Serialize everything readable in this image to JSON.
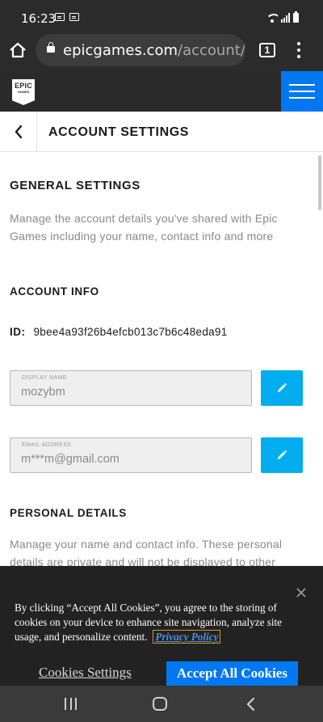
{
  "status_bar": {
    "time": "16:23"
  },
  "browser": {
    "url_host": "epicgames.com",
    "url_path": "/account/per",
    "tab_count": "1"
  },
  "site": {
    "logo_line1": "EPIC",
    "logo_line2": "GAMES"
  },
  "page": {
    "title": "ACCOUNT SETTINGS"
  },
  "general": {
    "heading": "GENERAL SETTINGS",
    "description": "Manage the account details you've shared with Epic Games including your name, contact info and more"
  },
  "account_info": {
    "heading": "ACCOUNT INFO",
    "id_label": "ID:",
    "id_value": "9bee4a93f26b4efcb013c7b6c48eda91",
    "display_name_label": "DISPLAY NAME",
    "display_name_value": "mozybm",
    "email_label": "EMAIL ADDRESS",
    "email_value": "m***m@gmail.com"
  },
  "personal_details": {
    "heading": "PERSONAL DETAILS",
    "description": "Manage your name and contact info. These personal details are private and will not be displayed to other"
  },
  "cookie_banner": {
    "text": "By clicking “Accept All Cookies”, you agree to the storing of cookies on your device to enhance site navigation, analyze site usage, and personalize content.",
    "privacy_link": "Privacy Policy",
    "settings_button": "Cookies Settings",
    "accept_button": "Accept All Cookies",
    "close_symbol": "×"
  },
  "icons": {
    "home": "home-icon",
    "lock": "lock-icon",
    "menu": "kebab-menu-icon",
    "hamburger": "hamburger-menu-icon",
    "back": "chevron-left-icon",
    "edit": "pencil-icon",
    "close": "close-icon"
  },
  "colors": {
    "epic_blue": "#0078f2",
    "edit_button": "#00aeef",
    "header_dark": "#2a2a2a"
  }
}
